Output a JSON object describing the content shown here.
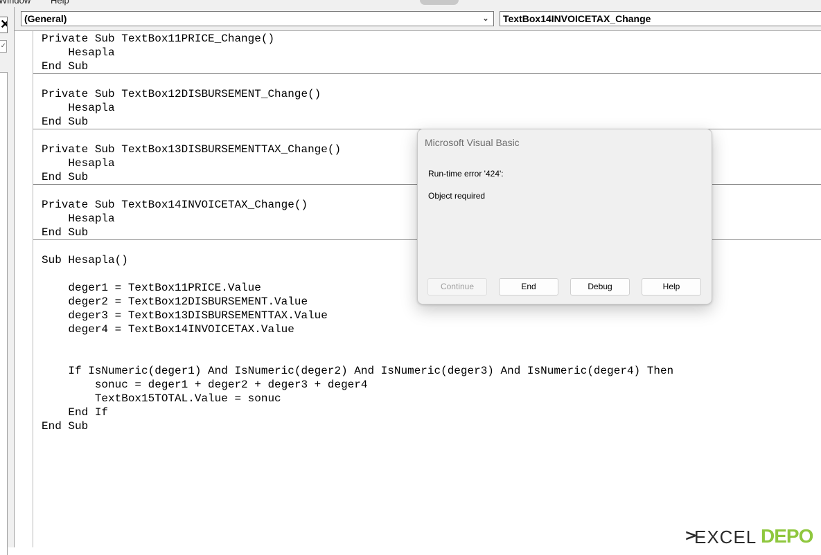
{
  "menu": {
    "items": [
      "Window",
      "Help"
    ]
  },
  "header": {
    "object_combo": "(General)",
    "procedure_combo": "TextBox14INVOICETAX_Change"
  },
  "code": {
    "lines": [
      "Private Sub TextBox11PRICE_Change()",
      "    Hesapla",
      "End Sub",
      "",
      "Private Sub TextBox12DISBURSEMENT_Change()",
      "    Hesapla",
      "End Sub",
      "",
      "Private Sub TextBox13DISBURSEMENTTAX_Change()",
      "    Hesapla",
      "End Sub",
      "",
      "Private Sub TextBox14INVOICETAX_Change()",
      "    Hesapla",
      "End Sub",
      "",
      "Sub Hesapla()",
      "",
      "    deger1 = TextBox11PRICE.Value",
      "    deger2 = TextBox12DISBURSEMENT.Value",
      "    deger3 = TextBox13DISBURSEMENTTAX.Value",
      "    deger4 = TextBox14INVOICETAX.Value",
      "",
      "",
      "    If IsNumeric(deger1) And IsNumeric(deger2) And IsNumeric(deger3) And IsNumeric(deger4) Then",
      "        sonuc = deger1 + deger2 + deger3 + deger4",
      "        TextBox15TOTAL.Value = sonuc",
      "    End If",
      "End Sub"
    ]
  },
  "dialog": {
    "title": "Microsoft Visual Basic",
    "error_line": "Run-time error '424':",
    "message": "Object required",
    "buttons": {
      "continue": "Continue",
      "end": "End",
      "debug": "Debug",
      "help": "Help"
    }
  },
  "logo": {
    "part1": "EXCEL",
    "part2": "DEPO"
  }
}
